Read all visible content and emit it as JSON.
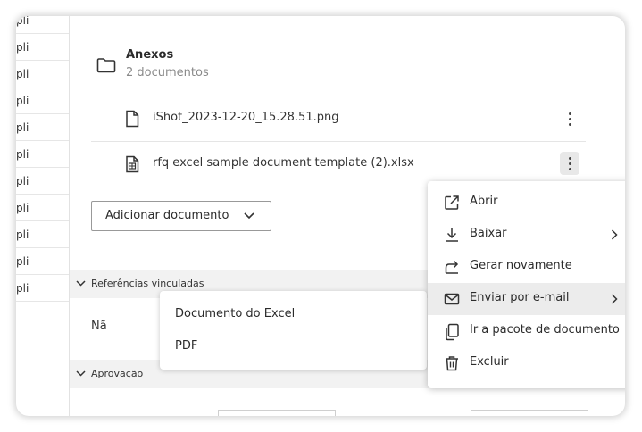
{
  "left_list": {
    "items": [
      "pli",
      "pli",
      "pli",
      "pli",
      "pli",
      "pli",
      "pli",
      "pli",
      "pli",
      "pli",
      "pli"
    ]
  },
  "attachments": {
    "title": "Anexos",
    "count_text": "2 documentos",
    "files": [
      {
        "name": "iShot_2023-12-20_15.28.51.png",
        "icon": "file-icon"
      },
      {
        "name": "rfq excel sample document template (2).xlsx",
        "icon": "spreadsheet-file-icon"
      }
    ],
    "add_button_label": "Adicionar documento"
  },
  "sections": {
    "linked_refs": "Referências vinculadas",
    "approval": "Aprovação",
    "linked_refs_body": "Nã"
  },
  "email_submenu": {
    "items": [
      "Documento do Excel",
      "PDF"
    ]
  },
  "context_menu": {
    "items": [
      {
        "label": "Abrir",
        "icon": "open-external-icon"
      },
      {
        "label": "Baixar",
        "icon": "download-icon"
      },
      {
        "label": "Gerar novamente",
        "icon": "regenerate-icon"
      },
      {
        "label": "Enviar por e-mail",
        "icon": "mail-icon"
      },
      {
        "label": "Ir a pacote de documento",
        "icon": "copy-documents-icon"
      },
      {
        "label": "Excluir",
        "icon": "trash-icon"
      }
    ],
    "highlighted": "Enviar por e-mail"
  }
}
